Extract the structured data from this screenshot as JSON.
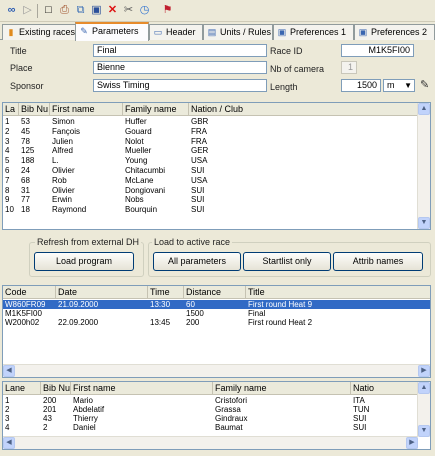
{
  "toolbar": {
    "icons": [
      "infinity-icon",
      "play-icon",
      "new-document-icon",
      "print-icon",
      "copy-icon",
      "save-icon",
      "delete-icon",
      "tools-icon",
      "stopwatch-icon",
      "flag-icon"
    ],
    "glyphs": [
      "∞",
      "▷",
      "□",
      "⎙",
      "⧉",
      "▣",
      "✕",
      "✂",
      "◷",
      "⚑"
    ]
  },
  "tabs": [
    {
      "label": "Existing races",
      "icon": "book-icon",
      "glyph": "▮"
    },
    {
      "label": "Parameters",
      "icon": "wrench-icon",
      "glyph": "✎"
    },
    {
      "label": "Header",
      "icon": "header-icon",
      "glyph": "▭"
    },
    {
      "label": "Units / Rules",
      "icon": "units-icon",
      "glyph": "▤"
    },
    {
      "label": "Preferences 1",
      "icon": "preferences-icon",
      "glyph": "▣"
    },
    {
      "label": "Preferences 2",
      "icon": "preferences-icon",
      "glyph": "▣"
    }
  ],
  "form": {
    "title_label": "Title",
    "title_value": "Final",
    "race_id_label": "Race ID",
    "race_id_value": "M1K5FI00",
    "place_label": "Place",
    "place_value": "Bienne",
    "nb_camera_label": "Nb of camera",
    "nb_camera_value": "1",
    "sponsor_label": "Sponsor",
    "sponsor_value": "Swiss Timing",
    "length_label": "Length",
    "length_value": "1500",
    "length_unit": "m",
    "edit_icon": "pencil-icon"
  },
  "startlist": {
    "columns": [
      "La",
      "Bib Nu",
      "First name",
      "Family name",
      "Nation / Club"
    ],
    "rows": [
      [
        "1",
        "53",
        "Simon",
        "Huffer",
        "GBR"
      ],
      [
        "2",
        "45",
        "Fançois",
        "Gouard",
        "FRA"
      ],
      [
        "3",
        "78",
        "Julien",
        "Nolot",
        "FRA"
      ],
      [
        "4",
        "125",
        "Alfred",
        "Mueller",
        "GER"
      ],
      [
        "5",
        "188",
        "L.",
        "Young",
        "USA"
      ],
      [
        "6",
        "24",
        "Olivier",
        "Chitacumbi",
        "SUI"
      ],
      [
        "7",
        "68",
        "Rob",
        "McLane",
        "USA"
      ],
      [
        "8",
        "31",
        "Olivier",
        "Dongiovani",
        "SUI"
      ],
      [
        "9",
        "77",
        "Erwin",
        "Nobs",
        "SUI"
      ],
      [
        "10",
        "18",
        "Raymond",
        "Bourquin",
        "SUI"
      ]
    ]
  },
  "refresh_group": {
    "title": "Refresh from external DH",
    "load_program": "Load program"
  },
  "load_group": {
    "title": "Load to active race",
    "all_parameters": "All parameters",
    "startlist_only": "Startlist only",
    "attrib_names": "Attrib names"
  },
  "races": {
    "columns": [
      "Code",
      "Date",
      "Time",
      "Distance",
      "Title"
    ],
    "rows": [
      [
        "W860FR09",
        "21.09.2000",
        "13:30",
        "60",
        "First round  Heat 9"
      ],
      [
        "M1K5FI00",
        "",
        "",
        "1500",
        "Final"
      ],
      [
        "W200h02",
        "22.09.2000",
        "13:45",
        "200",
        "First round  Heat 2"
      ]
    ],
    "selected_index": 0
  },
  "lanes": {
    "columns": [
      "Lane",
      "Bib Nu",
      "First name",
      "Family name",
      "Natio"
    ],
    "rows": [
      [
        "1",
        "200",
        "Mario",
        "Cristofori",
        "ITA"
      ],
      [
        "2",
        "201",
        "Abdelatif",
        "Grassa",
        "TUN"
      ],
      [
        "3",
        "43",
        "Thierry",
        "Gindraux",
        "SUI"
      ],
      [
        "4",
        "2",
        "Daniel",
        "Baumat",
        "SUI"
      ]
    ]
  },
  "colors": {
    "window": "#ece9d8",
    "selection": "#316ac5",
    "tab_accent": "#e68b2c",
    "border": "#7f9db9"
  }
}
